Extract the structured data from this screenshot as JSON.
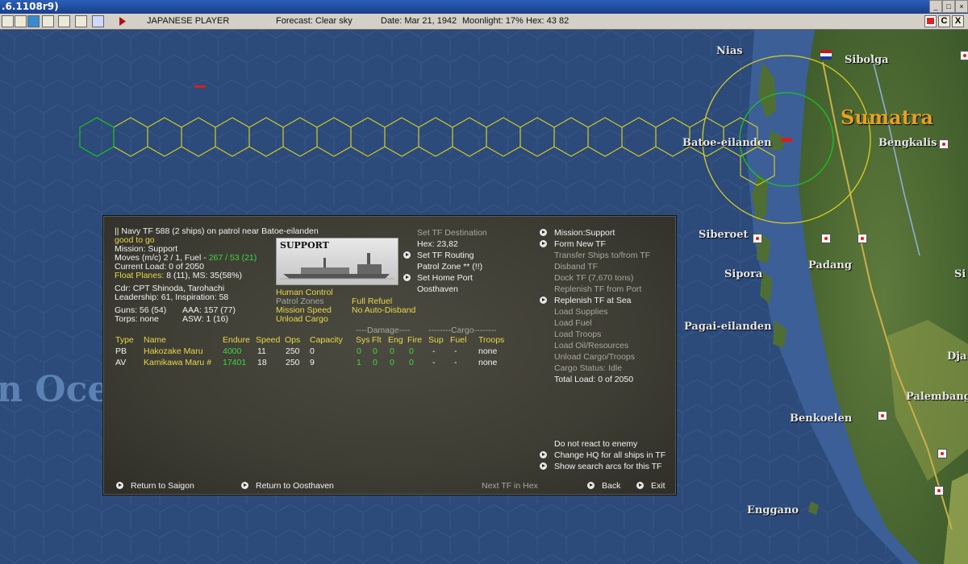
{
  "window": {
    "title": ".6.1108r9)"
  },
  "toolbar": {
    "player": "JAPANESE PLAYER",
    "forecast": "Forecast: Clear sky",
    "date": "Date: Mar 21, 1942",
    "moonlight": "Moonlight: 17%",
    "hex": "Hex: 43 82",
    "right_buttons": [
      "flag",
      "C",
      "X"
    ]
  },
  "map": {
    "labels": {
      "nias": "Nias",
      "sibolga": "Sibolga",
      "sumatra": "Sumatra",
      "batoe": "Batoe-eilanden",
      "bengkalis": "Bengkalis",
      "siberoet": "Siberoet",
      "padang": "Padang",
      "sipora": "Sipora",
      "pagai": "Pagai-eilanden",
      "benkoelen": "Benkoelen",
      "palembang": "Palembang",
      "enggano": "Enggano",
      "dja": "Dja",
      "si": "Si",
      "ocean": "n Ocea"
    }
  },
  "panel": {
    "tf_header": "|| Navy TF 588 (2 ships)  on patrol near Batoe-eilanden",
    "status": "good to go",
    "mission": "Mission: Support",
    "moves_prefix": "Moves (m/c) 2 / 1, Fuel -",
    "moves_fuel": "267 / 53 (21)",
    "current_load": "Current Load: 0 of 2050",
    "float_planes_label": "Float Planes:",
    "float_planes_value": "8 (11), MS: 35(58%)",
    "cdr": "Cdr: CPT Shinoda, Tarohachi",
    "leadership": "Leadership: 61, Inspiration: 58",
    "guns": "Guns: 56 (54)",
    "aaa": "AAA: 157 (77)",
    "torps": "Torps: none",
    "asw": "ASW: 1 (16)",
    "ship_image_label": "SUPPORT",
    "controls_left": [
      "Human Control",
      "Patrol Zones",
      "Mission Speed",
      "Unload Cargo"
    ],
    "controls_right": [
      "Full Refuel",
      "No Auto-Disband"
    ],
    "destination": {
      "title": "Set TF Destination",
      "hex": "Hex: 23,82",
      "routing": "Set TF Routing",
      "patrol_zone": "Patrol Zone ** (!!)",
      "home_port_label": "Set Home Port",
      "home_port": "Oosthaven"
    },
    "table": {
      "damage_header": "----Damage----",
      "cargo_header": "--------Cargo--------",
      "headers": [
        "Type",
        "Name",
        "Endure",
        "Speed",
        "Ops",
        "Capacity",
        "Sys",
        "Flt",
        "Eng",
        "Fire",
        "Sup",
        "Fuel",
        "Troops"
      ],
      "rows": [
        {
          "type": "PB",
          "name": "Hakozake Maru",
          "endure": "4000",
          "speed": "11",
          "ops": "250",
          "capacity": "0",
          "sys": "0",
          "flt": "0",
          "eng": "0",
          "fire": "0",
          "sup": "-",
          "fuel": "-",
          "troops": "none"
        },
        {
          "type": "AV",
          "name": "Kamikawa Maru #",
          "endure": "17401",
          "speed": "18",
          "ops": "250",
          "capacity": "9",
          "sys": "1",
          "flt": "0",
          "eng": "0",
          "fire": "0",
          "sup": "-",
          "fuel": "-",
          "troops": "none"
        }
      ]
    },
    "actions": [
      "Mission:Support",
      "Form New TF",
      "Transfer Ships to/from TF",
      "Disband TF",
      "Dock TF (7,670 tons)",
      "Replenish TF from Port",
      "Replenish TF at Sea",
      "Load Supplies",
      "Load Fuel",
      "Load Troops",
      "Load Oil/Resources",
      "Unload Cargo/Troops",
      "Cargo Status: Idle",
      "Total Load: 0 of 2050"
    ],
    "bottom_options": [
      "Do not react to enemy",
      "Change HQ for all ships in TF",
      "Show search arcs for this TF"
    ],
    "footer": {
      "return_saigon": "Return to Saigon",
      "return_oosthaven": "Return to Oosthaven",
      "next_tf": "Next TF in Hex",
      "back": "Back",
      "exit": "Exit"
    }
  }
}
